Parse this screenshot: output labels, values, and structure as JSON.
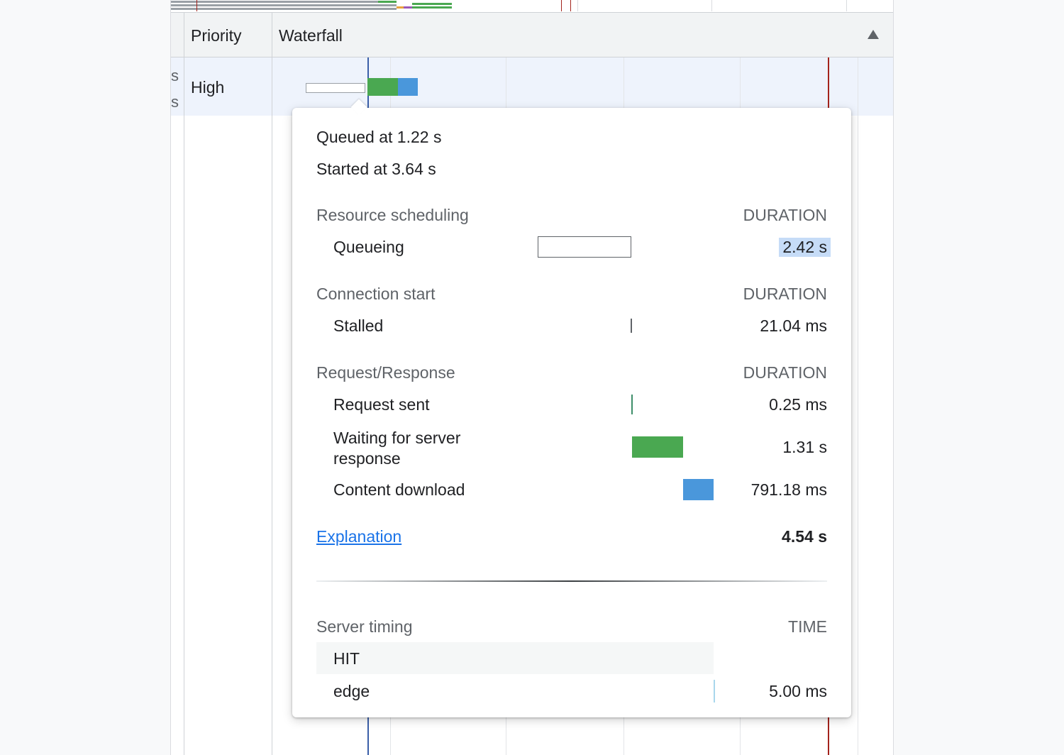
{
  "columns": {
    "priority": "Priority",
    "waterfall": "Waterfall"
  },
  "row": {
    "truncated_1": "s",
    "truncated_2": "s",
    "priority": "High"
  },
  "timing": {
    "queued_at": "Queued at 1.22 s",
    "started_at": "Started at 3.64 s",
    "sections": [
      {
        "title": "Resource scheduling",
        "header": "DURATION",
        "items": [
          {
            "label": "Queueing",
            "value": "2.42 s"
          }
        ]
      },
      {
        "title": "Connection start",
        "header": "DURATION",
        "items": [
          {
            "label": "Stalled",
            "value": "21.04 ms"
          }
        ]
      },
      {
        "title": "Request/Response",
        "header": "DURATION",
        "items": [
          {
            "label": "Request sent",
            "value": "0.25 ms"
          },
          {
            "label": "Waiting for server response",
            "value": "1.31 s"
          },
          {
            "label": "Content download",
            "value": "791.18 ms"
          }
        ]
      }
    ],
    "explanation": "Explanation",
    "total": "4.54 s",
    "server_timing": {
      "title": "Server timing",
      "header": "TIME",
      "items": [
        {
          "label": "HIT",
          "value": ""
        },
        {
          "label": "edge",
          "value": "5.00 ms"
        }
      ]
    }
  },
  "colors": {
    "waiting_bar": "#4aa851",
    "download_bar": "#4a97db",
    "selected_row": "#eef3fc",
    "link": "#1a73e8",
    "highlight": "#c6dcf7"
  }
}
